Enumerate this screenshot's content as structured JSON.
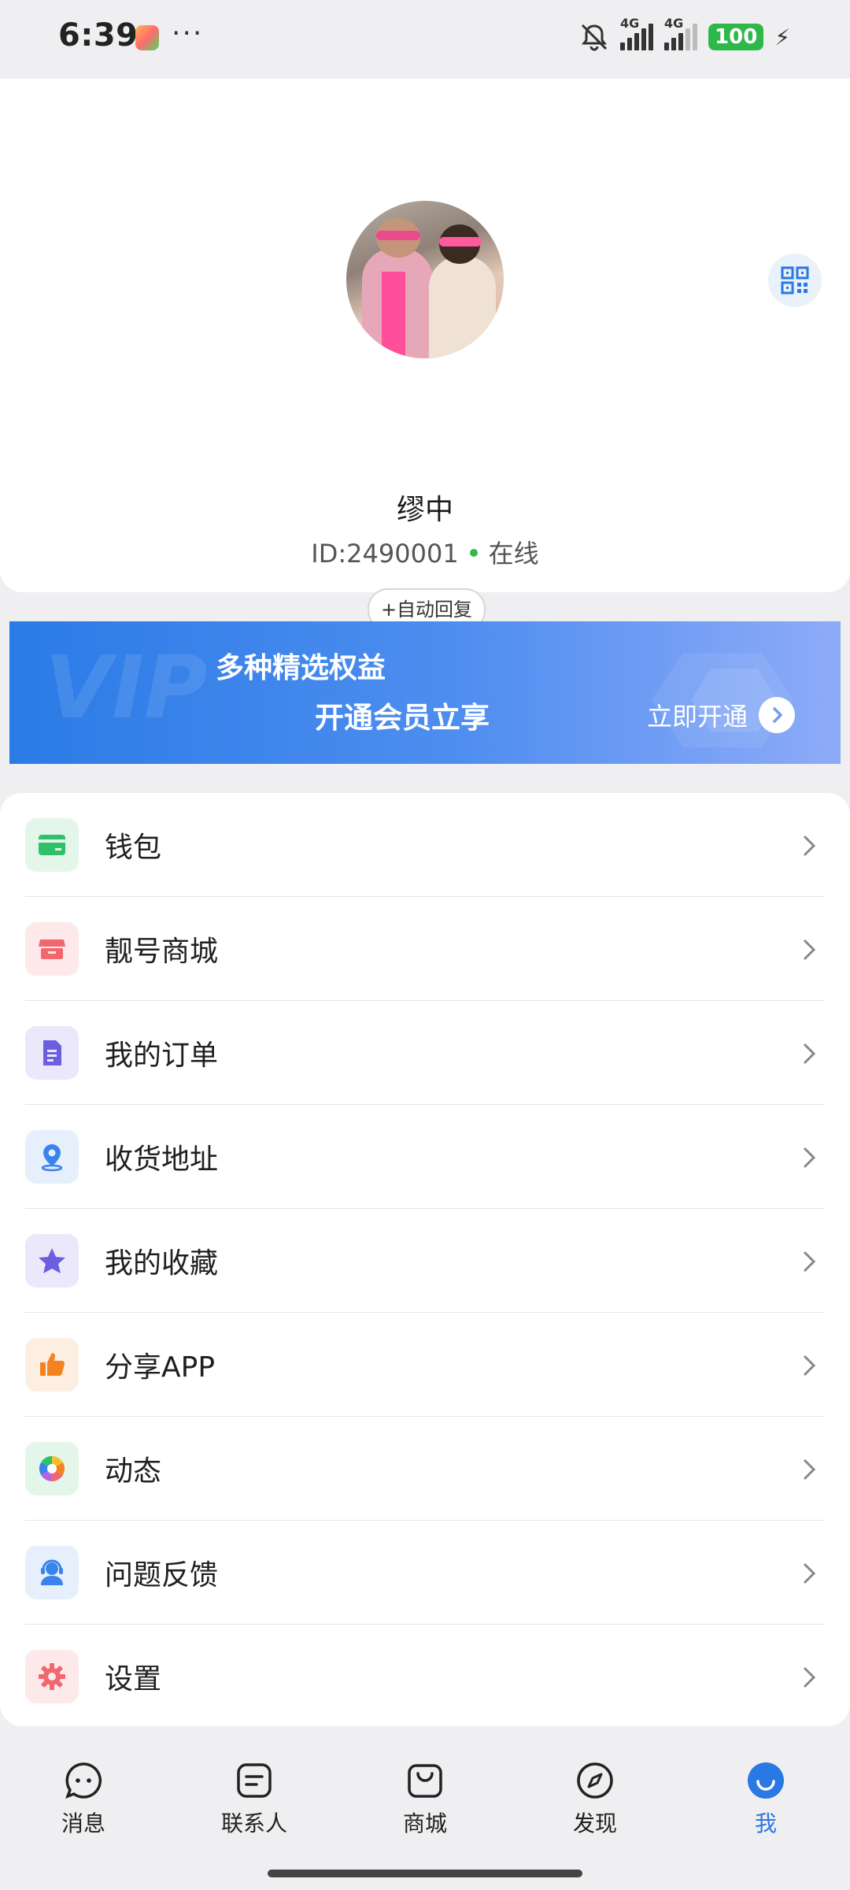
{
  "status_bar": {
    "time": "6:39",
    "more": "···",
    "network_1": "4G",
    "network_2": "4G",
    "battery": "100"
  },
  "profile": {
    "name": "缪中",
    "id_label": "ID:2490001",
    "status": "在线",
    "status_color": "#3ab54a",
    "auto_reply_label": "+自动回复"
  },
  "vip": {
    "line1": "多种精选权益",
    "line2": "开通会员立享",
    "cta": "立即开通",
    "watermark": "VIP"
  },
  "menu": [
    {
      "label": "钱包",
      "icon": "wallet-icon",
      "bg": "#e4f6ea",
      "fg": "#2fc06a"
    },
    {
      "label": "靓号商城",
      "icon": "store-icon",
      "bg": "#fde9ea",
      "fg": "#f0676e"
    },
    {
      "label": "我的订单",
      "icon": "order-document-icon",
      "bg": "#ebe8fb",
      "fg": "#6b5fe0"
    },
    {
      "label": "收货地址",
      "icon": "location-pin-icon",
      "bg": "#e6effc",
      "fg": "#3a83ec"
    },
    {
      "label": "我的收藏",
      "icon": "star-icon",
      "bg": "#ebe8fb",
      "fg": "#6b5fe0"
    },
    {
      "label": "分享APP",
      "icon": "thumbs-up-icon",
      "bg": "#fdeee2",
      "fg": "#f58220"
    },
    {
      "label": "动态",
      "icon": "aperture-icon",
      "bg": "#e4f6ea",
      "fg": "#2fc06a"
    },
    {
      "label": "问题反馈",
      "icon": "support-agent-icon",
      "bg": "#e6effc",
      "fg": "#3a83ec"
    },
    {
      "label": "设置",
      "icon": "gear-icon",
      "bg": "#fde9ea",
      "fg": "#f0676e"
    }
  ],
  "nav": [
    {
      "label": "消息",
      "icon": "chat-bubble-icon",
      "active": false
    },
    {
      "label": "联系人",
      "icon": "contacts-icon",
      "active": false
    },
    {
      "label": "商城",
      "icon": "shopping-bag-icon",
      "active": false
    },
    {
      "label": "发现",
      "icon": "compass-icon",
      "active": false
    },
    {
      "label": "我",
      "icon": "me-smile-icon",
      "active": true
    }
  ],
  "colors": {
    "accent": "#2a78e4",
    "background": "#efeff1"
  }
}
